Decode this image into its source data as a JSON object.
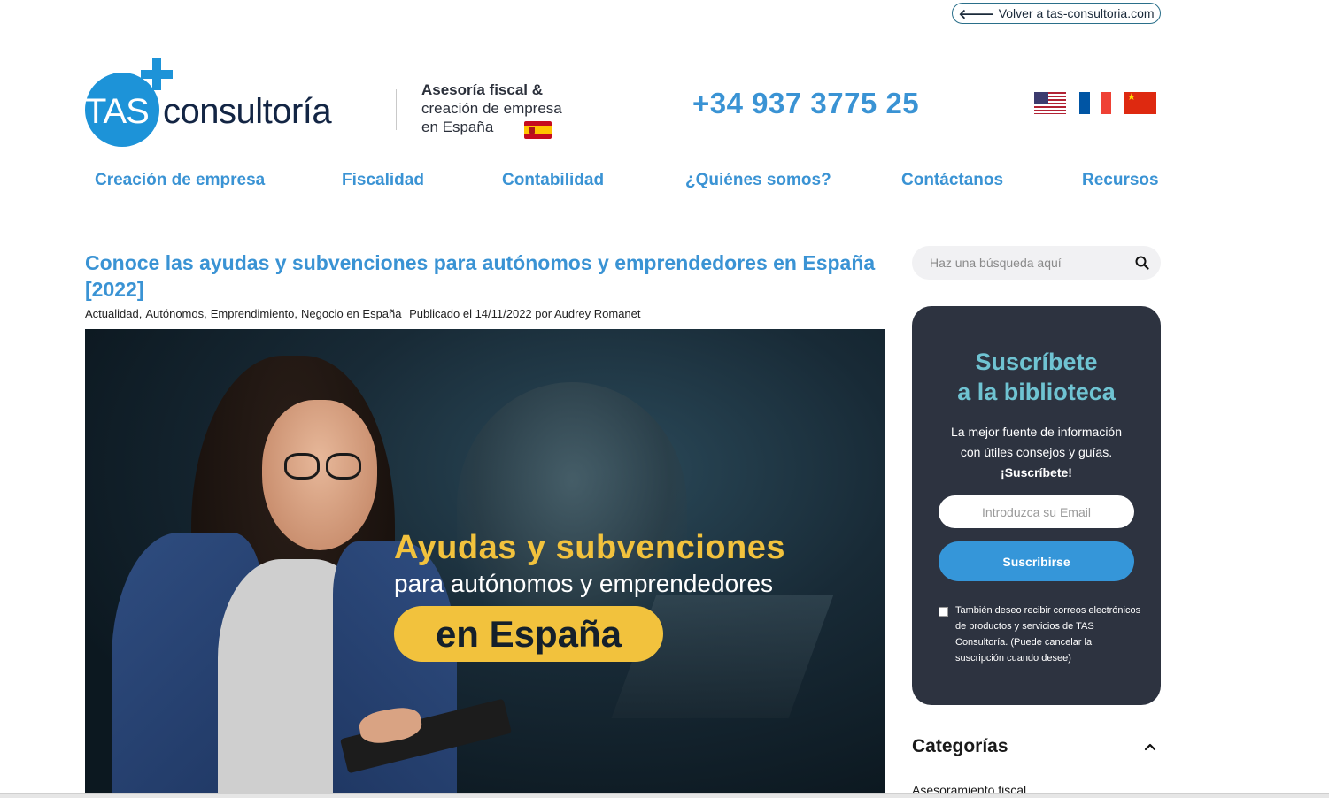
{
  "back_link": {
    "arrow": "🡐",
    "label": "Volver a tas-consultoria.com"
  },
  "logo": {
    "tas": "TAS",
    "consultoria": "consultoría"
  },
  "tagline": {
    "line1": "Asesoría fiscal &",
    "line2": "creación de empresa",
    "line3": "en España"
  },
  "phone": "+34 937 3775 25",
  "languages": [
    "English",
    "Français",
    "中文"
  ],
  "nav": [
    "Creación de empresa",
    "Fiscalidad",
    "Contabilidad",
    "¿Quiénes somos?",
    "Contáctanos",
    "Recursos"
  ],
  "article": {
    "title": "Conoce las ayudas y subvenciones para autónomos y emprendedores en España [2022]",
    "categories": [
      "Actualidad",
      "Autónomos",
      "Emprendimiento",
      "Negocio en España"
    ],
    "published": "Publicado el 14/11/2022 por Audrey Romanet",
    "hero": {
      "line1": "Ayudas y subvenciones",
      "line2": "para autónomos y emprendedores",
      "line3": "en España"
    }
  },
  "sidebar": {
    "search_placeholder": "Haz una búsqueda aquí",
    "subscribe": {
      "title_line1": "Suscríbete",
      "title_line2": "a la biblioteca",
      "desc_line1": "La mejor fuente de información",
      "desc_line2": "con útiles consejos y guías.",
      "cta": "¡Suscríbete!",
      "email_placeholder": "Introduzca su Email",
      "button": "Suscribirse",
      "consent": "También deseo recibir correos electrónicos de productos y servicios de TAS Consultoría. (Puede cancelar la suscripción cuando desee)"
    },
    "categories_heading": "Categorías",
    "categories": [
      "Asesoramiento fiscal"
    ]
  },
  "colors": {
    "accent": "#3a93d4",
    "logo_blue": "#1d93d8",
    "panel": "#2d3340",
    "teal": "#6fc3d2",
    "yellow": "#f2c23d"
  }
}
